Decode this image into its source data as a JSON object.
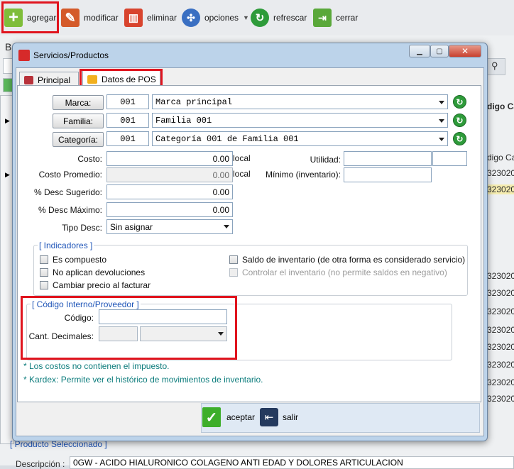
{
  "toolbar": {
    "add": "agregar",
    "modify": "modificar",
    "delete": "eliminar",
    "options": "opciones",
    "refresh": "refrescar",
    "close": "cerrar"
  },
  "background": {
    "label_b": "B",
    "header_col": "digo Ca",
    "header_col2": "digo Cal",
    "rows": [
      "323020",
      "323020",
      "323020",
      "323020",
      "323020",
      "323020",
      "323020",
      "323020",
      "323020",
      "323020"
    ],
    "selected_product": "[ Producto Seleccionado ]",
    "description_label": "Descripción :",
    "description_value": "0GW - ACIDO HIALURONICO COLAGENO ANTI EDAD Y DOLORES ARTICULACION"
  },
  "dialog": {
    "title": "Servicios/Productos",
    "tabs": [
      "Principal",
      "Datos de POS"
    ],
    "brand": {
      "button": "Marca:",
      "code": "001",
      "value": "Marca principal"
    },
    "family": {
      "button": "Familia:",
      "code": "001",
      "value": "Familia 001"
    },
    "category": {
      "button": "Categoría:",
      "code": "001",
      "value": "Categoría 001 de Familia 001"
    },
    "cost": {
      "label": "Costo:",
      "value": "0.00",
      "unit": "local"
    },
    "avg_cost": {
      "label": "Costo Promedio:",
      "value": "0.00",
      "unit": "local"
    },
    "suggested_discount": {
      "label": "% Desc Sugerido:",
      "value": "0.00"
    },
    "max_discount": {
      "label": "% Desc Máximo:",
      "value": "0.00"
    },
    "discount_type": {
      "label": "Tipo Desc:",
      "value": "Sin asignar"
    },
    "utility": {
      "label": "Utilidad:",
      "value": "",
      "value2": ""
    },
    "min_inventory": {
      "label": "Mínimo (inventario):",
      "value": ""
    },
    "indicators": {
      "title": "[ Indicadores ]",
      "is_compound": "Es compuesto",
      "no_returns": "No aplican devoluciones",
      "change_price": "Cambiar precio al facturar",
      "inventory_balance": "Saldo de inventario (de otra forma es considerado servicio)",
      "control_inventory": "Controlar el inventario (no permite saldos en negativo)"
    },
    "internal_code": {
      "title": "[ Código Interno/Proveedor ]",
      "code_label": "Código:",
      "code_value": "",
      "decimals_label": "Cant. Decimales:",
      "decimals_value": "",
      "decimals_select": ""
    },
    "notes": [
      "* Los costos no contienen el impuesto.",
      "* Kardex: Permite ver el histórico de movimientos de inventario."
    ],
    "accept": "aceptar",
    "exit": "salir"
  },
  "colors": {
    "highlight": "#e0141e",
    "group_title": "#1f55b8",
    "note": "#0c7c7c",
    "accept_green": "#3dae2b"
  }
}
